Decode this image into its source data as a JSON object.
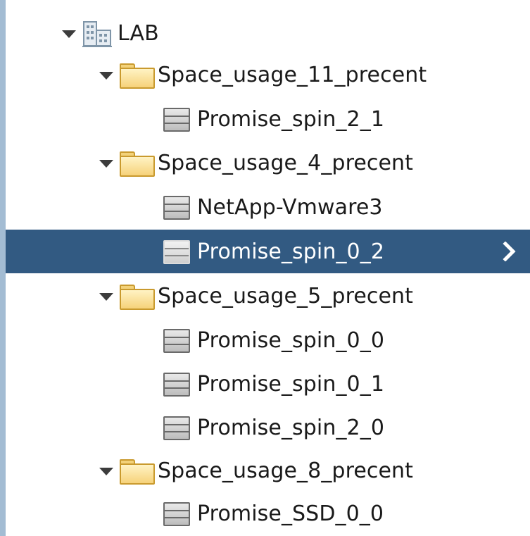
{
  "tree": {
    "datacenter": {
      "label": "LAB",
      "icon": "datacenter-icon",
      "expanded": true
    },
    "clusters": [
      {
        "label": "Space_usage_11_precent",
        "icon": "folder-icon",
        "expanded": true,
        "items": [
          {
            "label": "Promise_spin_2_1",
            "icon": "datastore-icon"
          }
        ]
      },
      {
        "label": "Space_usage_4_precent",
        "icon": "folder-icon",
        "expanded": true,
        "items": [
          {
            "label": "NetApp-Vmware3",
            "icon": "datastore-icon"
          },
          {
            "label": "Promise_spin_0_2",
            "icon": "datastore-icon",
            "selected": true
          }
        ]
      },
      {
        "label": "Space_usage_5_precent",
        "icon": "folder-icon",
        "expanded": true,
        "items": [
          {
            "label": "Promise_spin_0_0",
            "icon": "datastore-icon"
          },
          {
            "label": "Promise_spin_0_1",
            "icon": "datastore-icon"
          },
          {
            "label": "Promise_spin_2_0",
            "icon": "datastore-icon"
          }
        ]
      },
      {
        "label": "Space_usage_8_precent",
        "icon": "folder-icon",
        "expanded": true,
        "items": [
          {
            "label": "Promise_SSD_0_0",
            "icon": "datastore-icon"
          }
        ]
      }
    ]
  },
  "colors": {
    "selection": "#325a82",
    "left_border": "#a3bcd3",
    "folder": "#f6d27a"
  }
}
